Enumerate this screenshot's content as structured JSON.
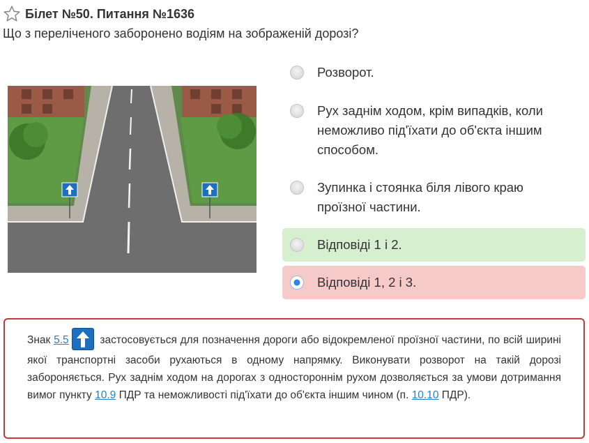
{
  "header": {
    "title": "Білет №50. Питання №1636",
    "favorite_icon": "star-outline-icon"
  },
  "question": "Що з переліченого заборонено водіям на зображеній дорозі?",
  "answers": [
    {
      "label": "Розворот.",
      "state": "neutral"
    },
    {
      "label": "Рух заднім ходом, крім випадків, коли неможливо під'їхати до об'єкта іншим способом.",
      "state": "neutral"
    },
    {
      "label": "Зупинка і стоянка біля лівого краю проїзної частини.",
      "state": "neutral"
    },
    {
      "label": "Відповіді 1 і 2.",
      "state": "correct"
    },
    {
      "label": "Відповіді 1, 2 і 3.",
      "state": "wrong-selected"
    }
  ],
  "explanation": {
    "t1": "Знак ",
    "link1": "5.5",
    "sign_icon": "one-way-road-sign-icon",
    "t2": " застосовується для позначення дороги або відокремленої проїзної частини, по всій ширині якої транспортні засоби рухаються в одному напрямку. Виконувати розворот на такій дорозі забороняється. Рух заднім ходом на дорогах з одностороннім рухом дозволяється за умови дотримання вимог пункту ",
    "link2": "10.9",
    "t3": " ПДР та неможливості під'їхати до об'єкта іншим чином (п. ",
    "link3": "10.10",
    "t4": " ПДР)."
  },
  "colors": {
    "correct_bg": "#d5efcf",
    "wrong_bg": "#f5cac8",
    "explain_border": "#c6373a",
    "link": "#2a7fc4",
    "radio_selected": "#2f86e0"
  }
}
